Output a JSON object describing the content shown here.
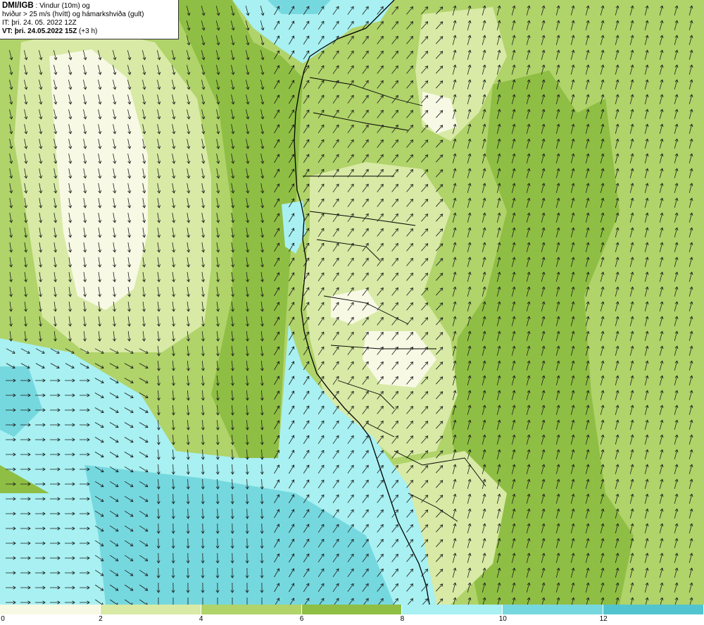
{
  "header": {
    "brand": "DMI/IGB",
    "line1_rest": " : Vindur (10m) og",
    "line2": "hviður > 25 m/s (hvítt) og hámarkshviða (gult)",
    "it_line": "IT: þri. 24. 05. 2022 12Z",
    "vt_label": "VT: þri. 24.05.2022 15Z",
    "vt_offset": " (+3 h)"
  },
  "legend": {
    "colors": [
      "#f7f9e5",
      "#d8eaa6",
      "#b0d36a",
      "#8fbe44",
      "#a8f0f2",
      "#76d8df",
      "#52c4cf"
    ],
    "ticks": [
      "0",
      "2",
      "4",
      "6",
      "8",
      "10",
      "12"
    ]
  },
  "map": {
    "land_outline_color": "#000000",
    "arrow_color": "#1a1a1a"
  }
}
